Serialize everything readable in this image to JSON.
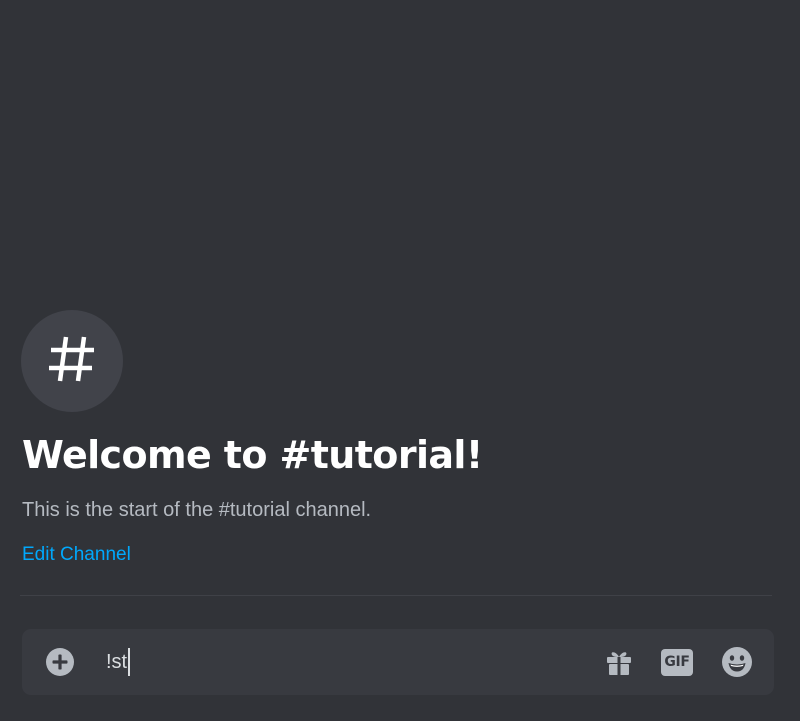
{
  "channel": {
    "name": "tutorial",
    "icon": "hashtag-icon"
  },
  "welcome": {
    "title": "Welcome to #tutorial!",
    "subtitle": "This is the start of the #tutorial channel.",
    "edit_link": "Edit Channel"
  },
  "composer": {
    "typed_text": "!st",
    "add_icon": "plus-circle-icon",
    "gift_icon": "gift-icon",
    "gif_label": "GIF",
    "emoji_icon": "smiley-emoji-icon"
  },
  "colors": {
    "background": "#313338",
    "composer_background": "#383a40",
    "icon_circle": "#41434a",
    "link": "#00a8fc",
    "muted_text": "#b5bac1",
    "title_text": "#ffffff"
  }
}
